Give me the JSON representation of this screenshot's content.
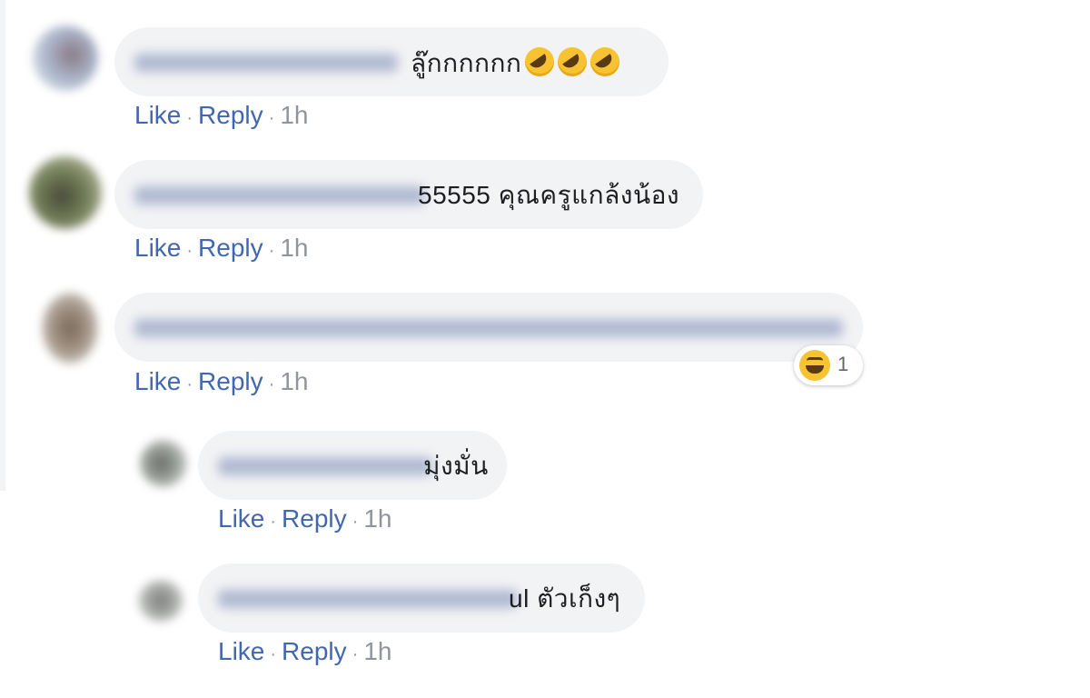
{
  "comments": [
    {
      "text": "ลู๊กกกกกก",
      "emoji": [
        "rolling-on-floor-laughing",
        "rolling-on-floor-laughing",
        "rolling-on-floor-laughing"
      ],
      "like": "Like",
      "reply": "Reply",
      "time": "1h"
    },
    {
      "text": "55555 คุณครูแกล้งน้อง",
      "like": "Like",
      "reply": "Reply",
      "time": "1h"
    },
    {
      "text": "",
      "like": "Like",
      "reply": "Reply",
      "time": "1h",
      "reaction": {
        "icon": "laughing-face",
        "count": "1"
      }
    }
  ],
  "replies": [
    {
      "text": "มุ่งมั่น",
      "like": "Like",
      "reply": "Reply",
      "time": "1h"
    },
    {
      "text": "ul ตัวเก็งๆ",
      "like": "Like",
      "reply": "Reply",
      "time": "1h"
    }
  ],
  "colors": {
    "link": "#4267b2",
    "bubble": "#f2f3f5",
    "muted": "#90949c",
    "emoji": "#f7c332"
  }
}
